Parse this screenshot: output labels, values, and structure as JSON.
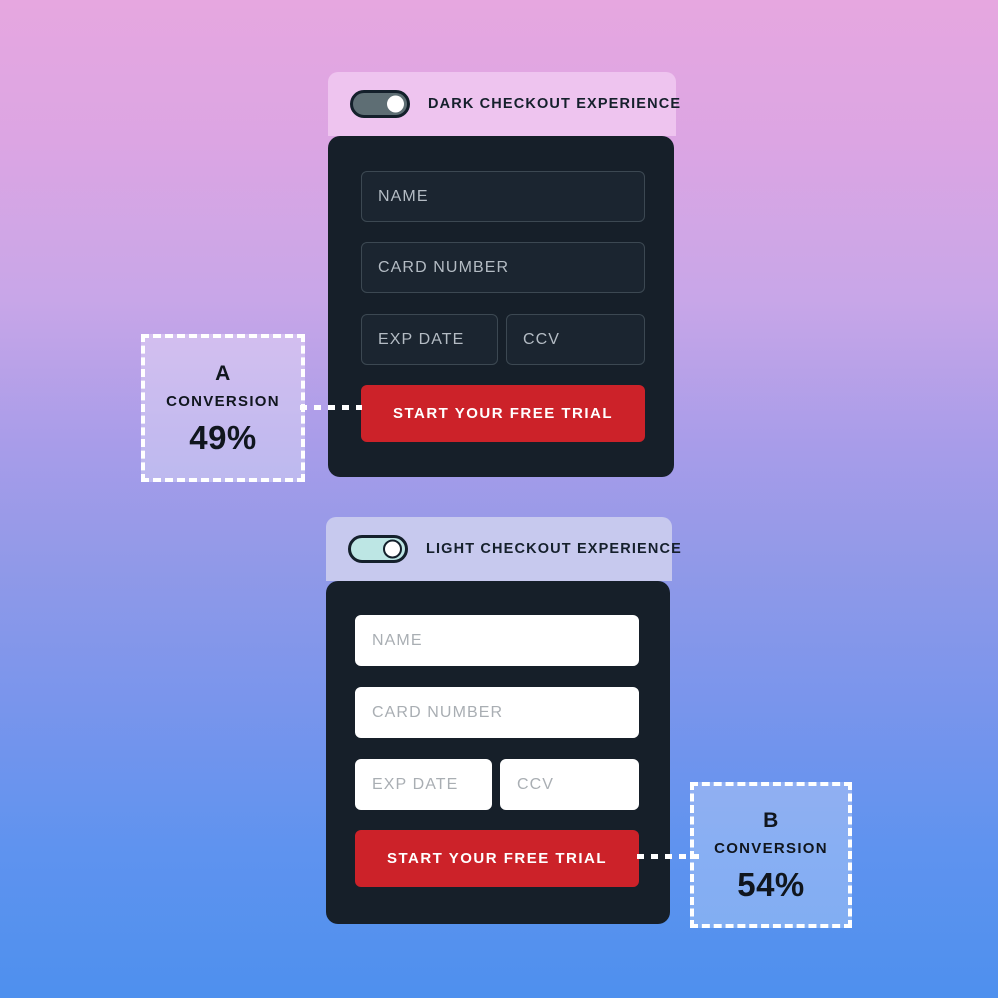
{
  "background": {
    "top_color": "#e6a7e0",
    "mid_color": "#9099e8",
    "bottom_color": "#4e90ee"
  },
  "accent": {
    "cta_red": "#cc2229",
    "card_dark": "#161f29",
    "badge_border": "#ffffff"
  },
  "variants": [
    {
      "id": "a",
      "header": {
        "label": "DARK CHECKOUT EXPERIENCE",
        "background": "#eec4ef",
        "toggle": {
          "name": "dark-mode-toggle",
          "state": "on",
          "track_color": "#5e6e74",
          "knob_color": "#ffffff"
        }
      },
      "form": {
        "theme": "dark",
        "fields": [
          {
            "name": "name-field",
            "placeholder": "NAME"
          },
          {
            "name": "card-number-field",
            "placeholder": "CARD NUMBER"
          },
          {
            "name": "exp-date-field",
            "placeholder": "EXP DATE"
          },
          {
            "name": "ccv-field",
            "placeholder": "CCV"
          }
        ],
        "cta_label": "START YOUR FREE TRIAL"
      },
      "badge": {
        "letter": "A",
        "metric_label": "CONVERSION",
        "value": "49%"
      }
    },
    {
      "id": "b",
      "header": {
        "label": "LIGHT CHECKOUT EXPERIENCE",
        "background": "#c7c9ee",
        "toggle": {
          "name": "light-mode-toggle",
          "state": "on",
          "track_color": "#bde6e4",
          "knob_color": "#ffffff"
        }
      },
      "form": {
        "theme": "light",
        "fields": [
          {
            "name": "name-field",
            "placeholder": "NAME"
          },
          {
            "name": "card-number-field",
            "placeholder": "CARD NUMBER"
          },
          {
            "name": "exp-date-field",
            "placeholder": "EXP DATE"
          },
          {
            "name": "ccv-field",
            "placeholder": "CCV"
          }
        ],
        "cta_label": "START YOUR FREE TRIAL"
      },
      "badge": {
        "letter": "B",
        "metric_label": "CONVERSION",
        "value": "54%"
      }
    }
  ]
}
